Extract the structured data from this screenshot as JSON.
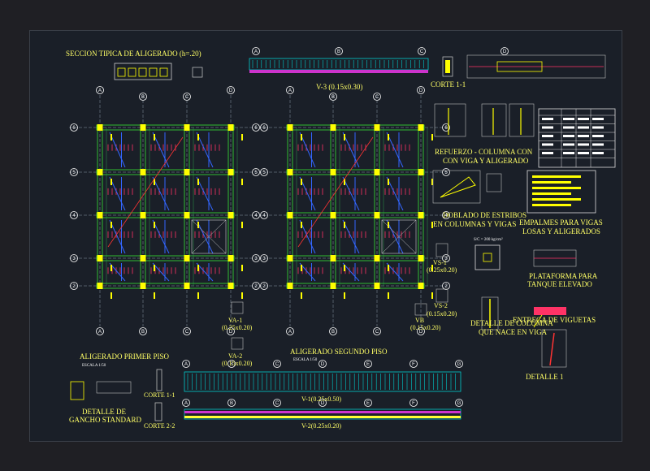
{
  "titles": {
    "seccion_tipica": "SECCION TIPICA DE ALIGERADO (h=.20)",
    "v3": "V-3 (0.15x0.30)",
    "corte_1_1_top": "CORTE 1-1",
    "refuerzo_line1": "REFUERZO - COLUMNA CON",
    "refuerzo_line2": "CON VIGA Y ALIGERADO",
    "doblado_line1": "DOBLADO DE ESTRIBOS",
    "doblado_line2": "EN COLUMNAS Y  VIGAS",
    "empalmes_line1": "EMPALMES PARA VIGAS",
    "empalmes_line2": "LOSAS Y ALIGERADOS",
    "sc_note": "S/C = 200 kg/cm²",
    "vs1_line1": "VS-1",
    "vs1_line2": "(0.25x0.20)",
    "plataforma_line1": "PLATAFORMA PARA",
    "plataforma_line2": "TANQUE ELEVADO",
    "vs2_line1": "VS-2",
    "vs2_line2": "(0.15x0.20)",
    "entrega": "ENTREGA DE VIGUETAS",
    "vb_line1": "VB",
    "vb_line2": "(0.15x0.20)",
    "detalle_columna_line1": "DETALLE DE COLUMNA",
    "detalle_columna_line2": "QUE NACE EN VIGA",
    "detalle_1": "DETALLE 1",
    "va1_line1": "VA-1",
    "va1_line2": "(0.25x0.20)",
    "va2_line1": "VA-2",
    "va2_line2": "(0.15x0.20)",
    "aligerado_primer": "ALIGERADO PRIMER PISO",
    "escala_1": "ESCALA 1/50",
    "aligerado_segundo": "ALIGERADO SEGUNDO PISO",
    "escala_2": "ESCALA 1/50",
    "detalle_gancho_line1": "DETALLE DE",
    "detalle_gancho_line2": "GANCHO STANDARD",
    "corte_1_1_bottom": "CORTE 1-1",
    "corte_2_2": "CORTE 2-2",
    "v1": "V-1(0.25x0.50)",
    "v2": "V-2(0.25x0.20)"
  },
  "axes": {
    "cols": [
      "A",
      "B",
      "C",
      "D"
    ],
    "rows": [
      "6",
      "5",
      "4",
      "3",
      "2"
    ],
    "beam_axes": [
      "A",
      "B",
      "C",
      "D",
      "E",
      "F",
      "G"
    ]
  },
  "colors": {
    "background": "#1a1f28",
    "text": "#ffff66",
    "column": "#ffff00",
    "beam": "#33cc33",
    "rebar": "#3366ff",
    "stirrup": "#ff3366",
    "axis": "#ffffff",
    "section_beam": "#00cccc"
  }
}
